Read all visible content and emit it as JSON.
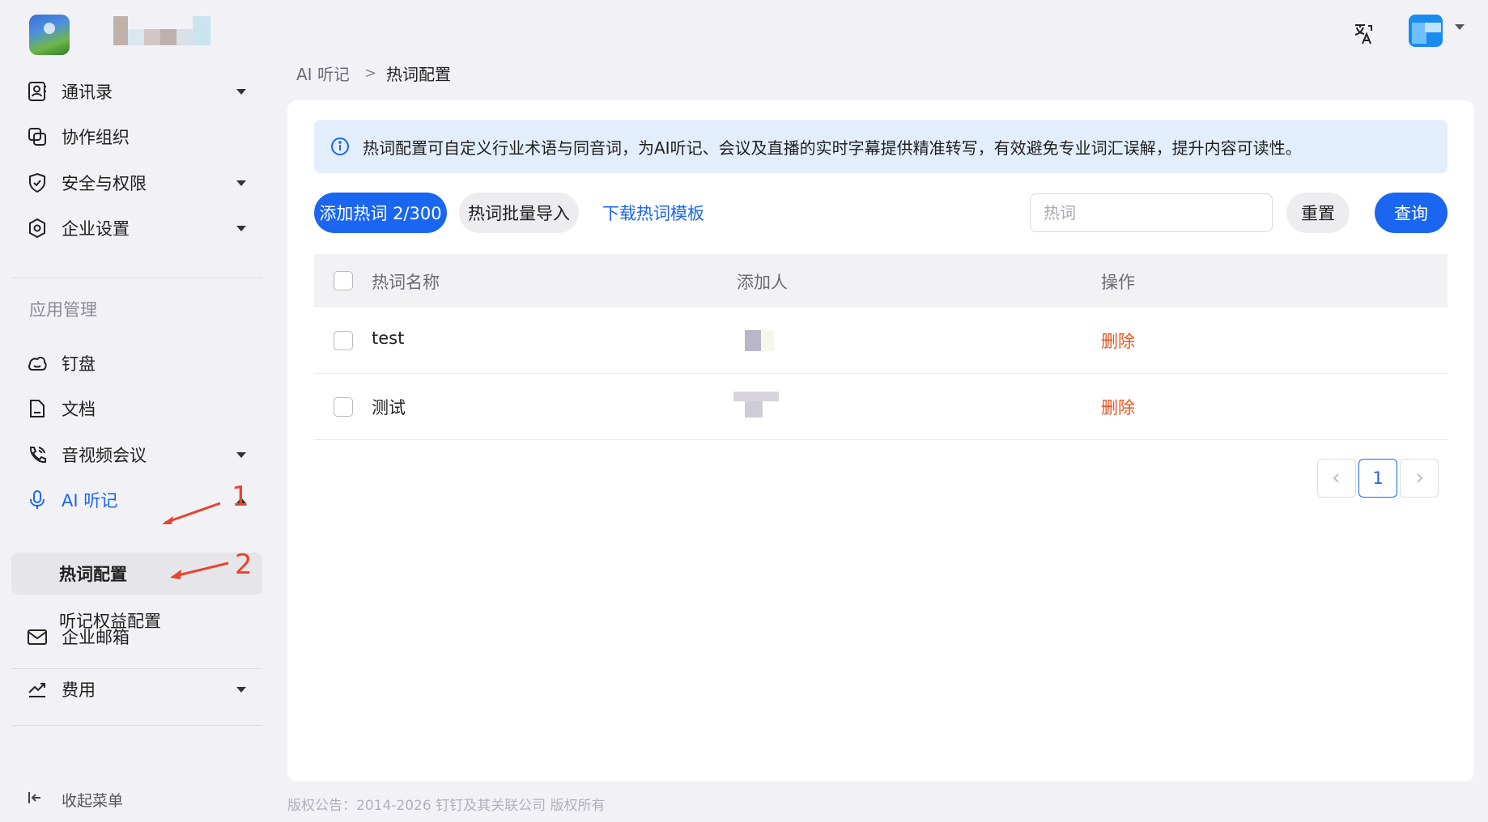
{
  "header": {
    "logo_icon": "app-logo",
    "translate_icon": "translate-icon",
    "avatar_color": "#1a8cf0"
  },
  "sidebar": {
    "items_top": [
      {
        "label": "通讯录",
        "icon": "contacts-icon",
        "has_caret": true
      },
      {
        "label": "协作组织",
        "icon": "collab-org-icon",
        "has_caret": false
      },
      {
        "label": "安全与权限",
        "icon": "shield-icon",
        "has_caret": true
      },
      {
        "label": "企业设置",
        "icon": "settings-icon",
        "has_caret": true
      }
    ],
    "section_title": "应用管理",
    "items_apps": [
      {
        "label": "钉盘",
        "icon": "cloud-icon"
      },
      {
        "label": "文档",
        "icon": "document-icon"
      },
      {
        "label": "音视频会议",
        "icon": "phone-icon"
      },
      {
        "label": "AI 听记",
        "icon": "microphone-icon"
      }
    ],
    "sub_items": [
      {
        "label": "热词配置",
        "selected": true
      },
      {
        "label": "听记权益配置",
        "selected": false
      }
    ],
    "mail_label": "企业邮箱",
    "fee_label": "费用",
    "collapse_label": "收起菜单"
  },
  "annotations": {
    "first": "1",
    "second": "2",
    "color": "#e8442d"
  },
  "breadcrumb": {
    "parent": "AI 听记",
    "current": "热词配置"
  },
  "notice": {
    "text": "热词配置可自定义行业术语与同音词，为AI听记、会议及直播的实时字幕提供精准转写，有效避免专业词汇误解，提升内容可读性。"
  },
  "toolbar": {
    "add_label": "添加热词 2/300",
    "import_label": "热词批量导入",
    "download_label": "下载热词模板",
    "search_placeholder": "热词",
    "search_value": "",
    "reset_label": "重置",
    "query_label": "查询"
  },
  "table": {
    "columns": [
      "热词名称",
      "添加人",
      "操作"
    ],
    "rows": [
      {
        "name": "test",
        "action": "删除"
      },
      {
        "name": "测试",
        "action": "删除"
      }
    ]
  },
  "pagination": {
    "current_page": "1"
  },
  "footer": {
    "text": "版权公告：2014-2026 钉钉及其关联公司 版权所有"
  },
  "colors": {
    "accent": "#1a66f0",
    "danger": "#e8541e",
    "notice_bg": "#e3eefc"
  }
}
